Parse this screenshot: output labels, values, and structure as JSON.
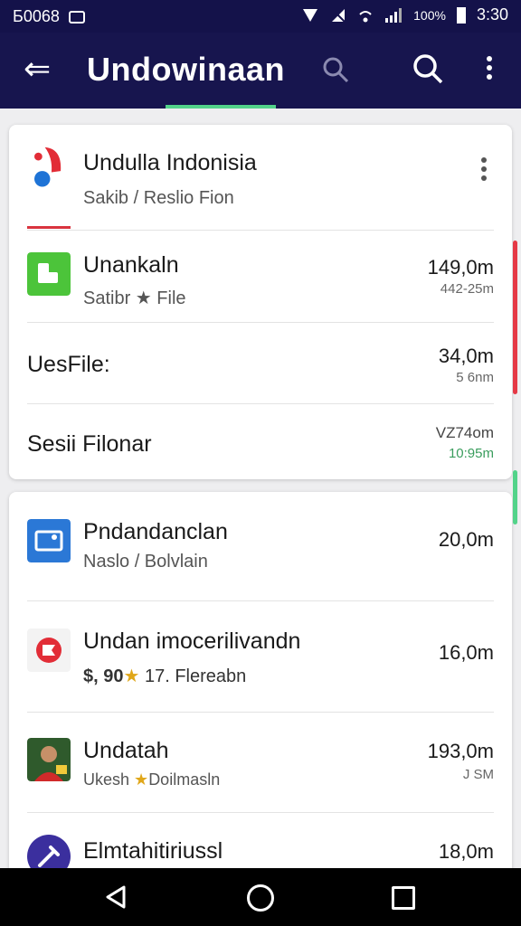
{
  "status_bar": {
    "left_text": "Б0068",
    "battery_text": "100%",
    "time": "3:30"
  },
  "app_bar": {
    "title": "Undowinaan"
  },
  "card1": {
    "header": {
      "name": "Undulla Indonisia",
      "sub": "Sakib / Reslio Fion"
    },
    "items": [
      {
        "name": "Unankaln",
        "sub": "Satibr ★ File",
        "size": "149,0m",
        "size_sub": "442-25m"
      },
      {
        "name": "UesFile:",
        "size": "34,0m",
        "size_sub": "5 6nm"
      },
      {
        "name": "Sesii Filonar",
        "size": "VZ74om",
        "size_sub": "10:95m"
      }
    ]
  },
  "card2": {
    "items": [
      {
        "name": "Pndandanclan",
        "sub": "Naslo / Bolvlain",
        "size": "20,0m"
      },
      {
        "name": "Undan imocerilivandn",
        "sub_prefix": "$, 90",
        "sub_suffix": "17. Flereabn",
        "size": "16,0m"
      },
      {
        "name": "Undatah",
        "sub_prefix": "Ukesh",
        "sub_suffix": "Doilmasln",
        "size": "193,0m",
        "size_sub": "J SM"
      },
      {
        "name": "Elmtahitiriussl",
        "size": "18,0m"
      }
    ]
  },
  "colors": {
    "app_bar": "#17154e",
    "accent_green": "#53d38a",
    "accent_red": "#e53946",
    "star": "#e0a71a"
  }
}
